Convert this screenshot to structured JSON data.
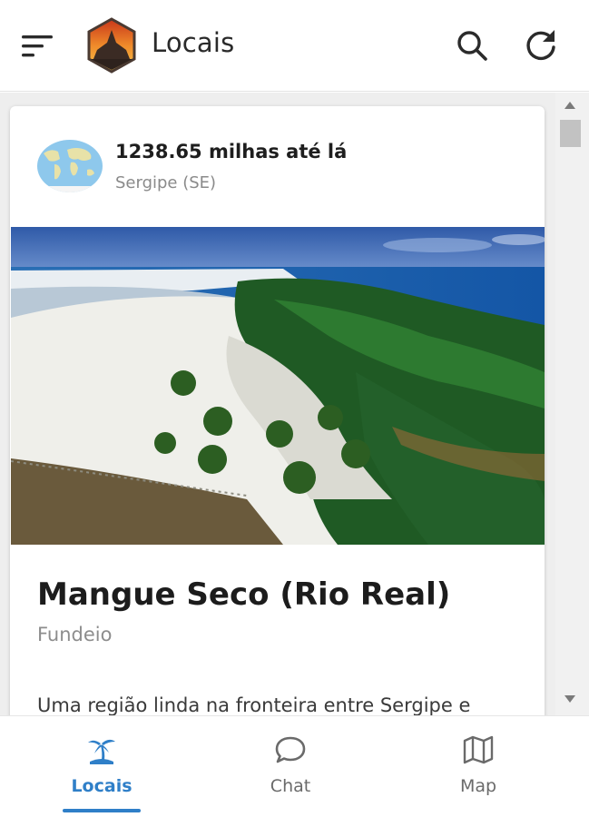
{
  "header": {
    "title": "Locais",
    "icons": [
      "menu-icon",
      "app-logo",
      "search-icon",
      "refresh-icon"
    ]
  },
  "card": {
    "distance": "1238.65 milhas até lá",
    "region": "Sergipe (SE)",
    "place_name": "Mangue Seco (Rio Real)",
    "place_type": "Fundeio",
    "description": "Uma região linda na fronteira entre Sergipe e"
  },
  "bottom_nav": {
    "items": [
      {
        "label": "Locais",
        "icon": "palm-tree-icon",
        "active": true
      },
      {
        "label": "Chat",
        "icon": "chat-bubble-icon",
        "active": false
      },
      {
        "label": "Map",
        "icon": "map-icon",
        "active": false
      }
    ]
  },
  "colors": {
    "accent": "#2f7fc8",
    "logo_border": "#c94a1a",
    "logo_dark": "#3a2a22"
  }
}
